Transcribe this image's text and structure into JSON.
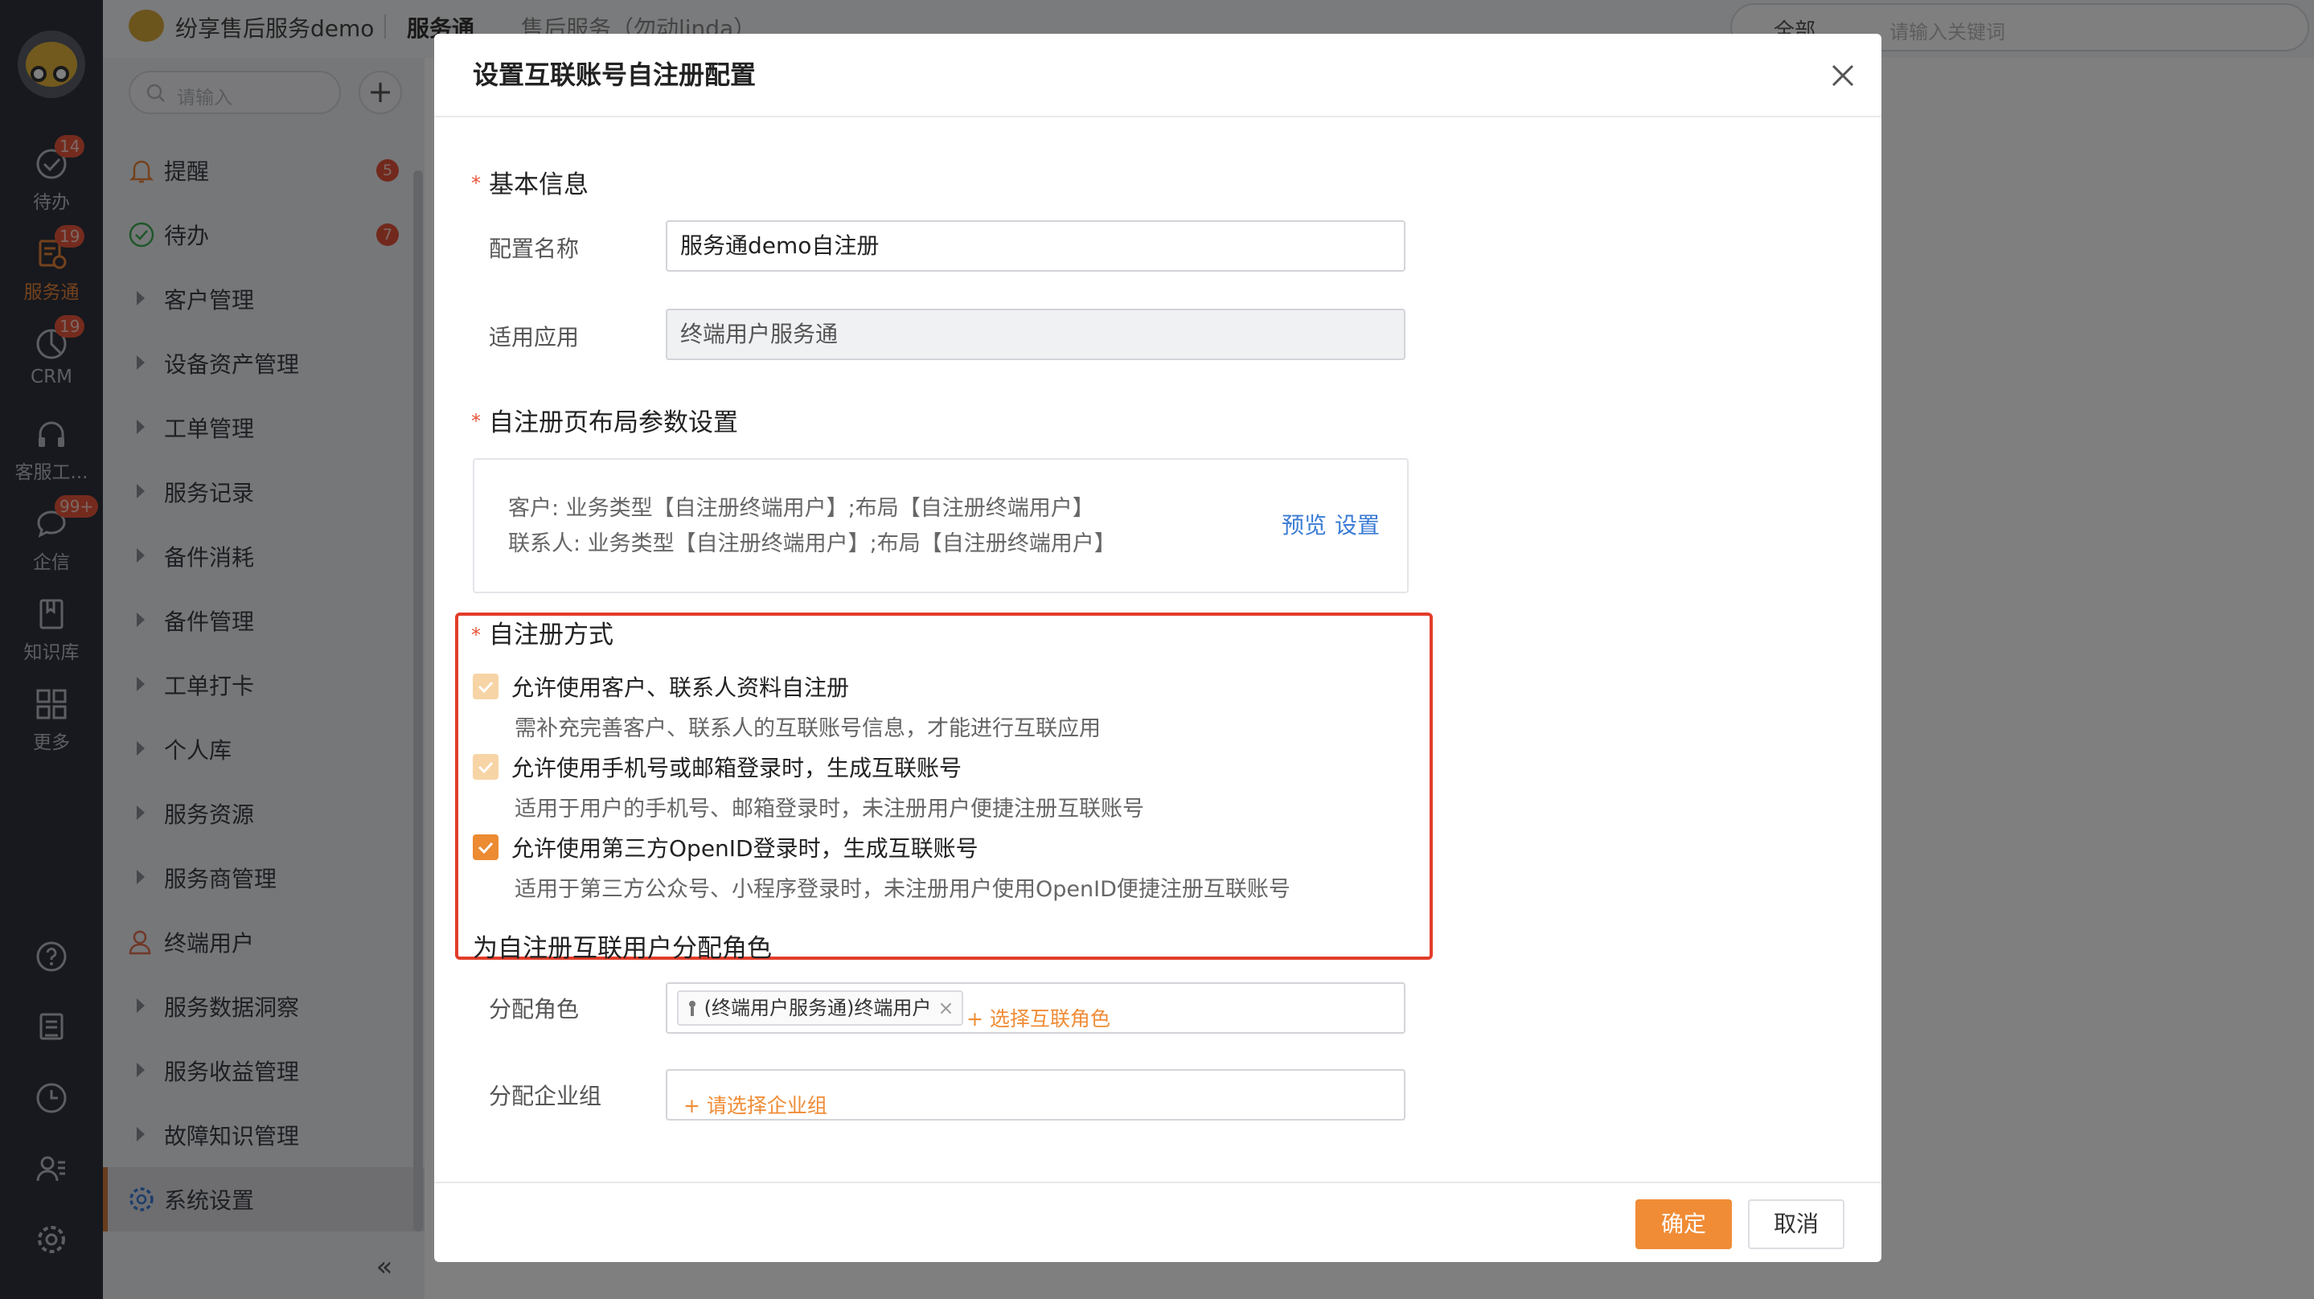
{
  "rail": {
    "items": [
      {
        "label": "待办",
        "badge": "14"
      },
      {
        "label": "服务通",
        "badge": "19"
      },
      {
        "label": "CRM",
        "badge": "19"
      },
      {
        "label": "客服工...",
        "badge": ""
      },
      {
        "label": "企信",
        "badge": "99+"
      },
      {
        "label": "知识库",
        "badge": ""
      },
      {
        "label": "更多",
        "badge": ""
      }
    ]
  },
  "sidebar": {
    "search_placeholder": "请输入",
    "add_label": "+",
    "items": [
      {
        "label": "提醒",
        "badge": "5"
      },
      {
        "label": "待办",
        "badge": "7"
      },
      {
        "label": "客户管理"
      },
      {
        "label": "设备资产管理"
      },
      {
        "label": "工单管理"
      },
      {
        "label": "服务记录"
      },
      {
        "label": "备件消耗"
      },
      {
        "label": "备件管理"
      },
      {
        "label": "工单打卡"
      },
      {
        "label": "个人库"
      },
      {
        "label": "服务资源"
      },
      {
        "label": "服务商管理"
      },
      {
        "label": "终端用户"
      },
      {
        "label": "服务数据洞察"
      },
      {
        "label": "服务收益管理"
      },
      {
        "label": "故障知识管理"
      },
      {
        "label": "系统设置"
      }
    ],
    "collapse_label": "«"
  },
  "topbar": {
    "app_name": "纷享售后服务demo",
    "module": "服务通",
    "workspace": "售后服务（勿动linda）",
    "search_scope": "全部",
    "search_placeholder": "请输入关键词"
  },
  "modal": {
    "title": "设置互联账号自注册配置",
    "basic_section": "基本信息",
    "config_name_label": "配置名称",
    "config_name_value": "服务通demo自注册",
    "app_label": "适用应用",
    "app_value": "终端用户服务通",
    "layout_section": "自注册页布局参数设置",
    "layout_line1": "客户: 业务类型【自注册终端用户】;布局【自注册终端用户】",
    "layout_line2": "联系人: 业务类型【自注册终端用户】;布局【自注册终端用户】",
    "preview_link": "预览",
    "settings_link": "设置",
    "method_section": "自注册方式",
    "options": [
      {
        "label": "允许使用客户、联系人资料自注册",
        "desc": "需补充完善客户、联系人的互联账号信息，才能进行互联应用",
        "checked": true,
        "disabled": true
      },
      {
        "label": "允许使用手机号或邮箱登录时，生成互联账号",
        "desc": "适用于用户的手机号、邮箱登录时，未注册用户便捷注册互联账号",
        "checked": true,
        "disabled": true
      },
      {
        "label": "允许使用第三方OpenID登录时，生成互联账号",
        "desc": "适用于第三方公众号、小程序登录时，未注册用户使用OpenID便捷注册互联账号",
        "checked": true,
        "disabled": false
      }
    ],
    "role_section": "为自注册互联用户分配角色",
    "role_label": "分配角色",
    "role_tag": "(终端用户服务通)终端用户",
    "role_tag_remove": "×",
    "role_add": "+ 选择互联角色",
    "group_label": "分配企业组",
    "group_add": "+ 请选择企业组",
    "ok_label": "确定",
    "cancel_label": "取消"
  },
  "colors": {
    "accent": "#f08c36",
    "highlight_border": "#e23d2a",
    "link": "#3a7bd5",
    "rail_bg": "#2e323d"
  }
}
